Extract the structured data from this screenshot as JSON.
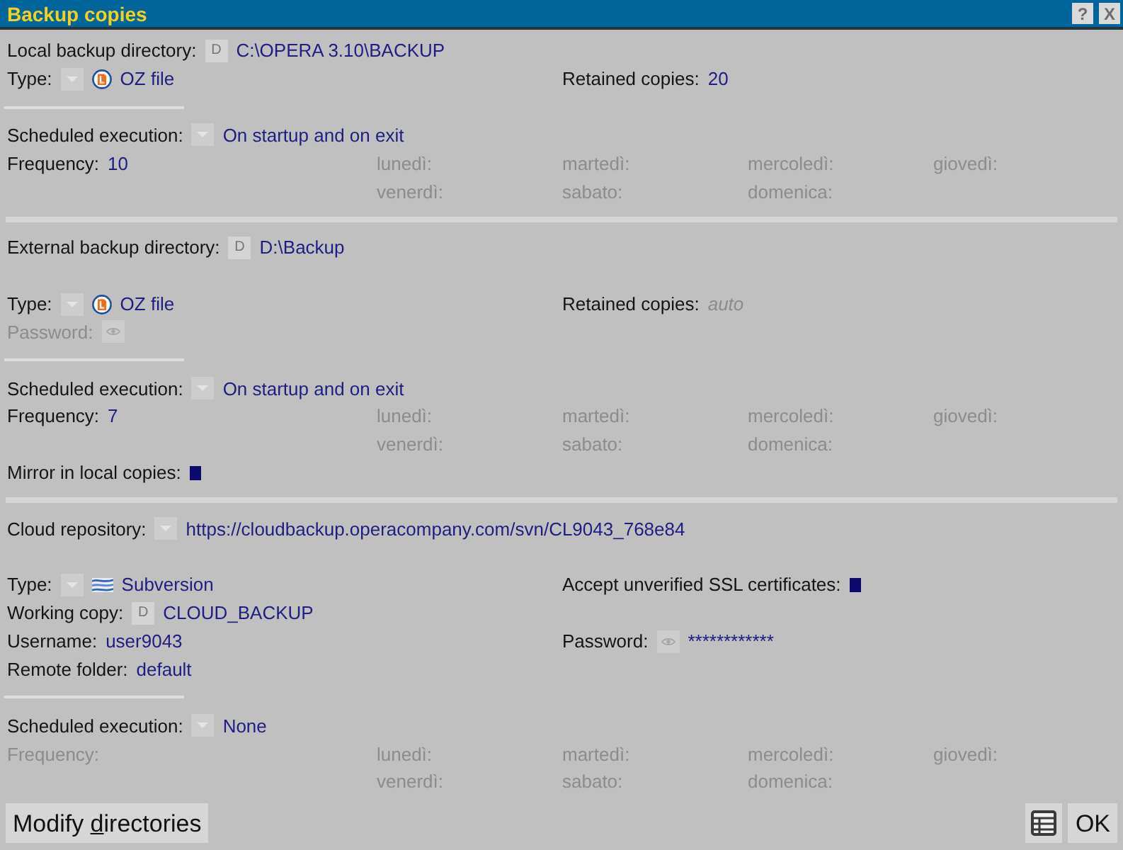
{
  "window": {
    "title": "Backup copies",
    "buttons": [
      {
        "label": "?"
      },
      {
        "label": "X"
      }
    ]
  },
  "sections": [
    {
      "groups": [
        {
          "rows": [
            {
              "kind": "fields",
              "left": {
                "kind": "path",
                "label": "Local backup directory:",
                "button": "D",
                "value": "C:\\OPERA 3.10\\BACKUP",
                "disabled": false
              }
            },
            {
              "kind": "fields",
              "left": {
                "kind": "file",
                "label": "Type:",
                "value": "OZ file",
                "disabled": false
              },
              "right": {
                "kind": "text",
                "label": "Retained copies:",
                "value": "20",
                "disabled": false
              }
            }
          ]
        },
        {
          "rows": [
            {
              "kind": "fields",
              "left": {
                "kind": "select",
                "label": "Scheduled execution:",
                "value": "On startup and on exit",
                "disabled": false
              }
            },
            {
              "kind": "frequency",
              "field": {
                "kind": "text",
                "label": "Frequency:",
                "value": "10",
                "disabled": false
              },
              "days": [
                {
                  "label": "lunedì:",
                  "disabled": true
                },
                {
                  "label": "martedì:",
                  "disabled": true
                },
                {
                  "label": "mercoledì:",
                  "disabled": true
                },
                {
                  "label": "giovedì:",
                  "disabled": true
                },
                {
                  "label": "venerdì:",
                  "disabled": true
                },
                {
                  "label": "sabato:",
                  "disabled": true
                },
                {
                  "label": "domenica:",
                  "disabled": true
                }
              ]
            }
          ]
        }
      ]
    },
    {
      "groups": [
        {
          "rows": [
            {
              "kind": "fields",
              "left": {
                "kind": "path",
                "label": "External backup directory:",
                "button": "D",
                "value": "D:\\Backup",
                "disabled": false
              }
            },
            {
              "kind": "blank"
            },
            {
              "kind": "fields",
              "left": {
                "kind": "file",
                "label": "Type:",
                "value": "OZ file",
                "disabled": false
              },
              "right": {
                "kind": "text",
                "label": "Retained copies:",
                "placeholder": "auto",
                "disabled": false
              }
            },
            {
              "kind": "fields",
              "left": {
                "kind": "secret",
                "label": "Password:",
                "disabled": true
              }
            }
          ]
        },
        {
          "rows": [
            {
              "kind": "fields",
              "left": {
                "kind": "select",
                "label": "Scheduled execution:",
                "value": "On startup and on exit",
                "disabled": false
              }
            },
            {
              "kind": "frequency",
              "field": {
                "kind": "text",
                "label": "Frequency:",
                "value": "7",
                "disabled": false
              },
              "days": [
                {
                  "label": "lunedì:",
                  "disabled": true
                },
                {
                  "label": "martedì:",
                  "disabled": true
                },
                {
                  "label": "mercoledì:",
                  "disabled": true
                },
                {
                  "label": "giovedì:",
                  "disabled": true
                },
                {
                  "label": "venerdì:",
                  "disabled": true
                },
                {
                  "label": "sabato:",
                  "disabled": true
                },
                {
                  "label": "domenica:",
                  "disabled": true
                }
              ]
            },
            {
              "kind": "fields",
              "left": {
                "kind": "check",
                "label": "Mirror in local copies:",
                "checked": true,
                "disabled": false
              }
            }
          ]
        }
      ]
    },
    {
      "groups": [
        {
          "rows": [
            {
              "kind": "fields",
              "left": {
                "kind": "select",
                "label": "Cloud repository:",
                "value": "https://cloudbackup.operacompany.com/svn/CL9043_768e84",
                "disabled": false
              }
            },
            {
              "kind": "blank"
            },
            {
              "kind": "fields",
              "left": {
                "kind": "svn",
                "label": "Type:",
                "value": "Subversion",
                "disabled": false
              },
              "right": {
                "kind": "check",
                "label": "Accept unverified SSL certificates:",
                "checked": true,
                "disabled": false
              }
            },
            {
              "kind": "fields",
              "left": {
                "kind": "path",
                "label": "Working copy:",
                "button": "D",
                "value": "CLOUD_BACKUP",
                "disabled": false
              }
            },
            {
              "kind": "fields",
              "left": {
                "kind": "text",
                "label": "Username:",
                "value": "user9043",
                "disabled": false
              },
              "right": {
                "kind": "secret",
                "label": "Password:",
                "value": "************",
                "disabled": false
              }
            },
            {
              "kind": "fields",
              "left": {
                "kind": "text",
                "label": "Remote folder:",
                "value": "default",
                "disabled": false
              }
            }
          ]
        },
        {
          "rows": [
            {
              "kind": "fields",
              "left": {
                "kind": "select",
                "label": "Scheduled execution:",
                "value": "None",
                "disabled": false
              }
            },
            {
              "kind": "frequency",
              "field": {
                "kind": "text",
                "label": "Frequency:",
                "disabled": true
              },
              "days": [
                {
                  "label": "lunedì:",
                  "disabled": true
                },
                {
                  "label": "martedì:",
                  "disabled": true
                },
                {
                  "label": "mercoledì:",
                  "disabled": true
                },
                {
                  "label": "giovedì:",
                  "disabled": true
                },
                {
                  "label": "venerdì:",
                  "disabled": true
                },
                {
                  "label": "sabato:",
                  "disabled": true
                },
                {
                  "label": "domenica:",
                  "disabled": true
                }
              ]
            }
          ]
        }
      ]
    }
  ],
  "footer": {
    "left_buttons": [
      {
        "kind": "text",
        "parts": [
          {
            "text": "Modify ",
            "underline": false
          },
          {
            "text": "d",
            "underline": true
          },
          {
            "text": "irectories",
            "underline": false
          }
        ]
      }
    ],
    "right_buttons": [
      {
        "kind": "table"
      },
      {
        "kind": "text",
        "parts": [
          {
            "text": "OK",
            "underline": false
          }
        ]
      }
    ]
  }
}
